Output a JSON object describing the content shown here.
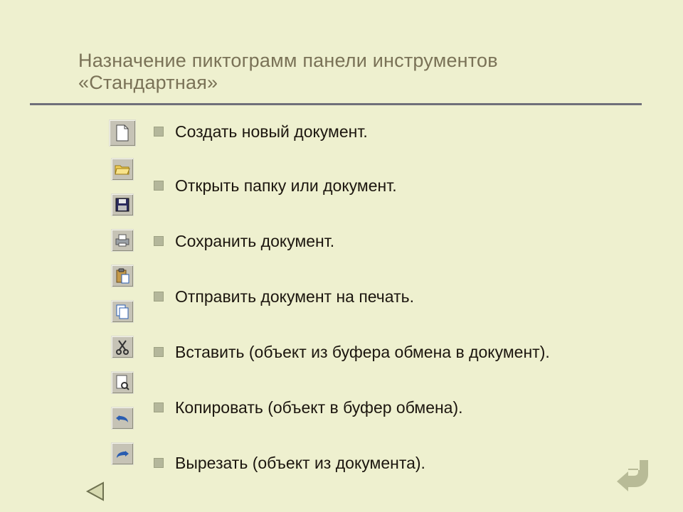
{
  "title": "Назначение пиктограмм панели инструментов «Стандартная»",
  "icons": [
    {
      "name": "new-document-icon"
    },
    {
      "name": "open-folder-icon"
    },
    {
      "name": "save-icon"
    },
    {
      "name": "print-icon"
    },
    {
      "name": "paste-icon"
    },
    {
      "name": "copy-icon"
    },
    {
      "name": "cut-icon"
    },
    {
      "name": "print-preview-icon"
    },
    {
      "name": "undo-icon"
    },
    {
      "name": "redo-icon"
    }
  ],
  "items": [
    {
      "label": "Создать новый документ."
    },
    {
      "label": "Открыть папку или документ."
    },
    {
      "label": "Сохранить документ."
    },
    {
      "label": "Отправить документ на печать."
    },
    {
      "label": "Вставить (объект из буфера обмена в документ)."
    },
    {
      "label": "Копировать (объект в буфер обмена)."
    },
    {
      "label": "Вырезать (объект из документа)."
    }
  ],
  "nav": {
    "prev": "prev-slide",
    "return": "return"
  }
}
